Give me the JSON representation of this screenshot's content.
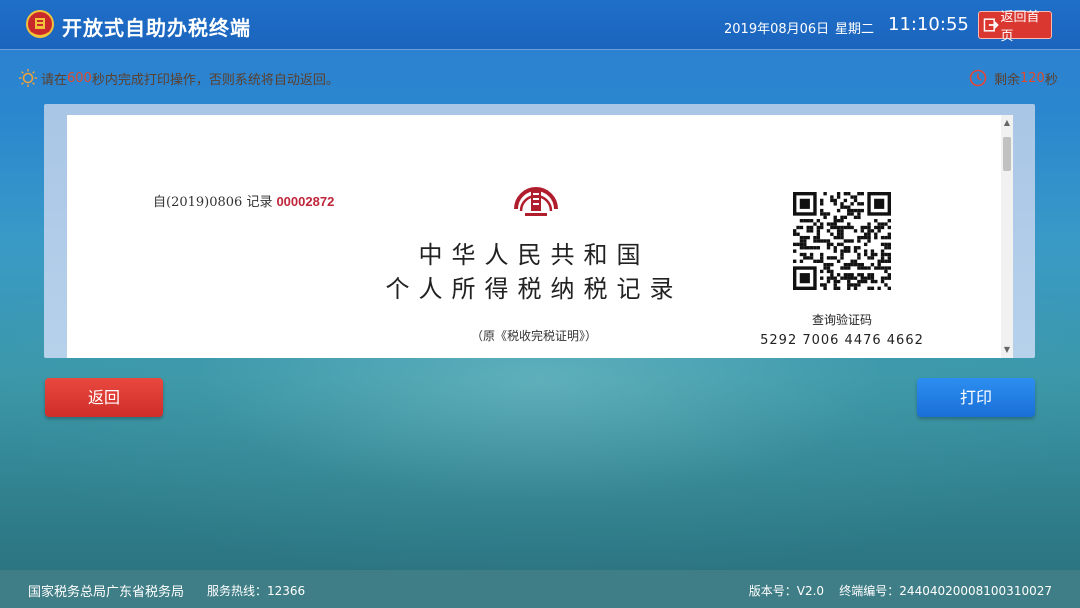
{
  "header": {
    "app_title": "开放式自助办税终端",
    "date": "2019年08月06日",
    "weekday": "星期二",
    "time": "11:10:55",
    "home_label": "返回首页"
  },
  "notice": {
    "prefix": "请在",
    "seconds": "600",
    "suffix": "秒内完成打印操作，否则系统将自动返回。"
  },
  "countdown": {
    "prefix": "剩余",
    "seconds": "120",
    "suffix": "秒"
  },
  "document": {
    "record_prefix": "自(2019)0806 记录",
    "record_number": "00002872",
    "title_line1": "中华人民共和国",
    "title_line2": "个人所得税纳税记录",
    "subtitle": "（原《税收完税证明》）",
    "verify_label": "查询验证码",
    "verify_code": "5292 7006 4476 4662"
  },
  "buttons": {
    "back": "返回",
    "print": "打印"
  },
  "footer": {
    "org": "国家税务总局广东省税务局",
    "hotline": "服务热线：12366",
    "version": "版本号：V2.0",
    "terminal": "终端编号：2440402000810031002‍7"
  },
  "icons": {
    "emblem": "tax-emblem-icon",
    "home": "exit-arrow-icon",
    "notice": "lightbulb-icon",
    "countdown": "clock-icon",
    "doc_logo": "tax-logo-icon",
    "qr": "qr-code-icon"
  },
  "colors": {
    "header_bg": "#1f6fc9",
    "accent_red": "#d9372f",
    "print_blue": "#1a6fd6",
    "record_red": "#c0263a",
    "footer_bg": "#3f7e86"
  }
}
